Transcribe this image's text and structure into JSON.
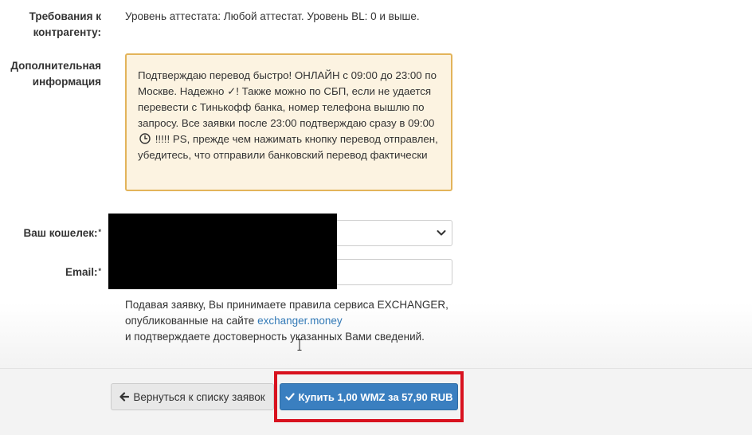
{
  "requirements": {
    "label_line1": "Требования к",
    "label_line2": "контрагенту:",
    "value": "Уровень аттестата: Любой аттестат. Уровень BL: 0 и выше."
  },
  "additional_info": {
    "label_line1": "Дополнительная",
    "label_line2": "информация",
    "text_part1": "Подтверждаю перевод быстро! ОНЛАЙН с 09:00 до 23:00 по Москве. Надежно ✓! Также можно по СБП, если не удается перевести с Тинькофф банка, номер телефона вышлю по запросу. Все заявки после 23:00 подтверждаю сразу в 09:00",
    "text_part2": "!!!!! PS, прежде чем нажимать кнопку перевод отправлен, убедитесь, что отправили банковский перевод фактически"
  },
  "wallet": {
    "label": "Ваш кошелек:",
    "required_mark": "*"
  },
  "email": {
    "label": "Email:",
    "required_mark": "*"
  },
  "terms": {
    "line1": "Подавая заявку, Вы принимаете правила сервиса EXCHANGER,",
    "line2_prefix": "опубликованные на сайте",
    "link": "exchanger.money",
    "line3": "и подтверждаете достоверность указанных Вами сведений."
  },
  "buttons": {
    "back_label": "Вернуться к списку заявок",
    "buy_label": "Купить 1,00 WMZ за 57,90 RUB"
  },
  "icons": {
    "back": "arrow-left-icon",
    "buy": "checkmark-icon",
    "select": "chevron-down-icon",
    "clock": "clock-icon"
  },
  "colors": {
    "primary_button": "#3a7fc0",
    "info_border": "#e3b45a",
    "info_bg": "#fcf3e1",
    "highlight": "#d8121f",
    "link": "#337ab7"
  }
}
